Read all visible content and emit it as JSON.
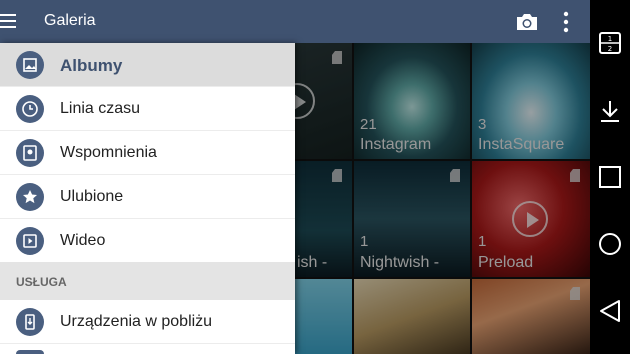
{
  "appbar": {
    "title": "Galeria",
    "color": "#3f5270"
  },
  "icons": {
    "menu": "hamburger-icon",
    "camera": "camera-icon",
    "overflow": "more-vert-icon"
  },
  "albums": [
    {
      "count": "21",
      "name": "Instagram"
    },
    {
      "count": "3",
      "name": "InstaSquare"
    },
    {
      "count": "1",
      "name": "ish -"
    },
    {
      "count": "1",
      "name": "Nightwish -"
    },
    {
      "count": "1",
      "name": "Preload"
    }
  ],
  "drawer": {
    "items": [
      {
        "label": "Albumy",
        "icon": "photo-album-icon",
        "active": true
      },
      {
        "label": "Linia czasu",
        "icon": "clock-icon"
      },
      {
        "label": "Wspomnienia",
        "icon": "memories-icon"
      },
      {
        "label": "Ulubione",
        "icon": "star-icon"
      },
      {
        "label": "Wideo",
        "icon": "video-icon"
      }
    ],
    "section_label": "USŁUGA",
    "service_items": [
      {
        "label": "Urządzenia w pobliżu",
        "icon": "nearby-devices-icon"
      }
    ]
  },
  "navbar": {
    "icons": [
      "split-screen-icon",
      "download-icon",
      "recents-icon",
      "home-icon",
      "back-icon"
    ]
  }
}
